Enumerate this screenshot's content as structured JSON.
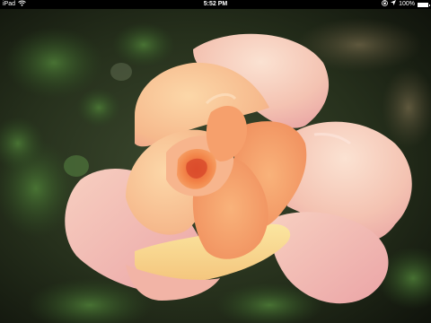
{
  "status_bar": {
    "device": "iPad",
    "time": "5:52 PM",
    "battery_percent": "100%",
    "battery_level": 1.0,
    "icons": [
      "wifi-icon",
      "lock-rotation-icon",
      "location-arrow-icon",
      "battery-icon"
    ]
  },
  "photo": {
    "subject": "rose",
    "colors": {
      "petal_peach": "#f6c7a9",
      "petal_orange": "#f0914e",
      "petal_pink": "#f3b7b9",
      "background_green": "#2e3c24"
    }
  }
}
